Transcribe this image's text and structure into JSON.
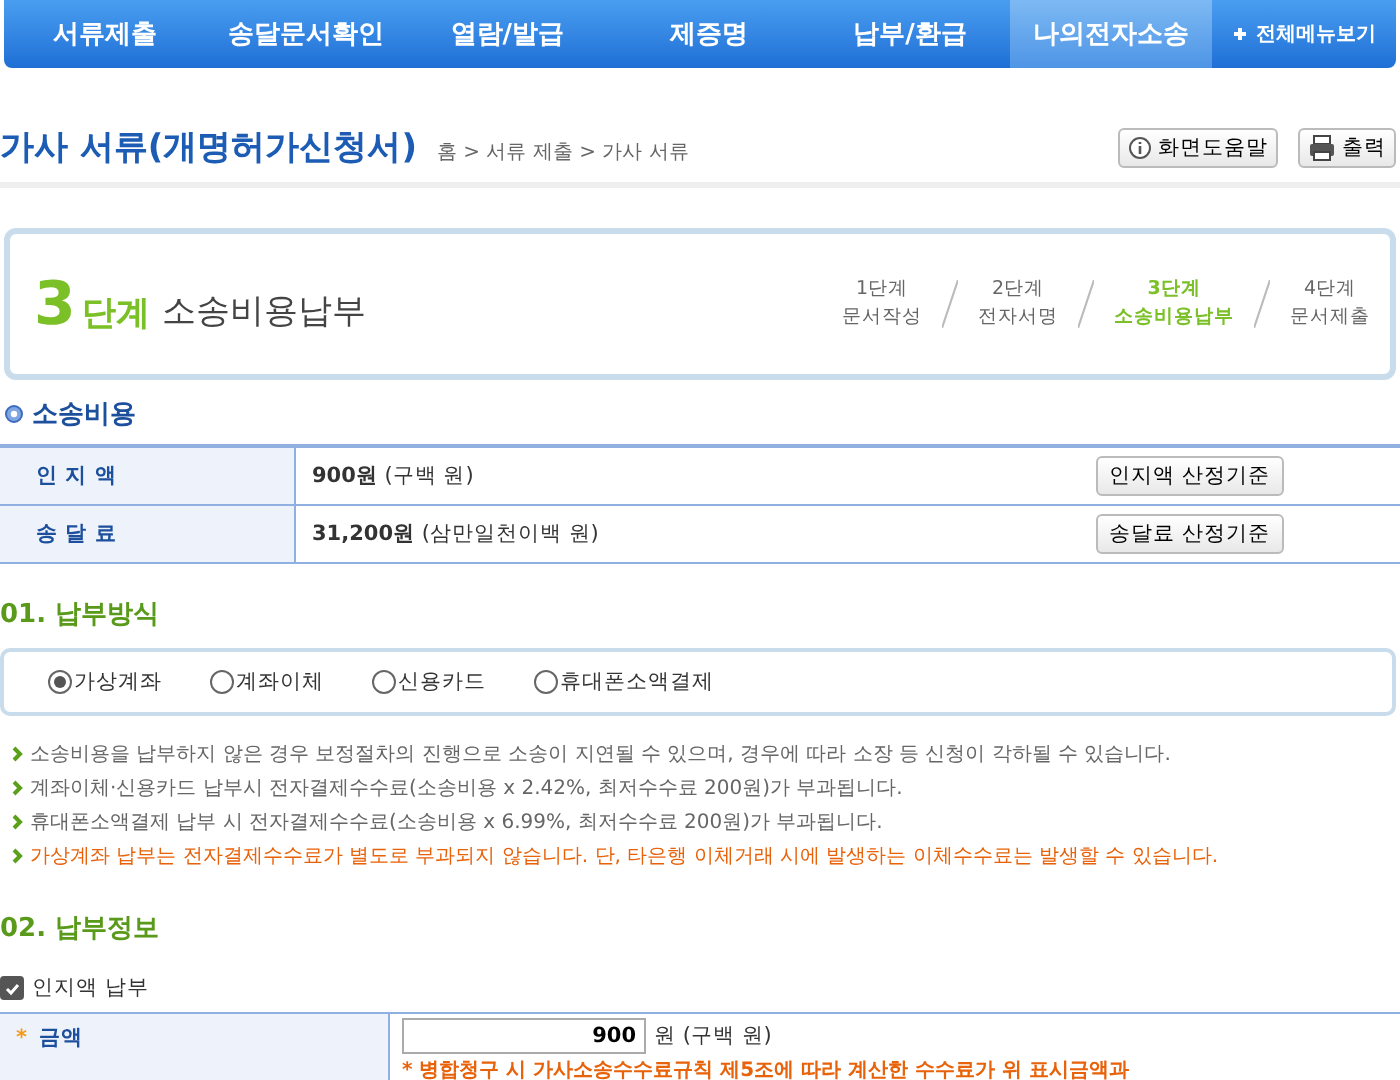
{
  "nav": {
    "items": [
      {
        "label": "서류제출",
        "selected": false
      },
      {
        "label": "송달문서확인",
        "selected": false
      },
      {
        "label": "열람/발급",
        "selected": false
      },
      {
        "label": "제증명",
        "selected": false
      },
      {
        "label": "납부/환급",
        "selected": false
      },
      {
        "label": "나의전자소송",
        "selected": true
      }
    ],
    "all_menu": "전체메뉴보기"
  },
  "header": {
    "title": "가사 서류(개명허가신청서)",
    "breadcrumb": "홈 > 서류 제출 > 가사 서류",
    "buttons": [
      {
        "label": "화면도움말",
        "kind": "help"
      },
      {
        "label": "출력",
        "kind": "print"
      }
    ]
  },
  "step": {
    "number": "3",
    "unit": "단계",
    "title": "소송비용납부",
    "steps": [
      {
        "line1": "1단계",
        "line2": "문서작성",
        "selected": false
      },
      {
        "line1": "2단계",
        "line2": "전자서명",
        "selected": false
      },
      {
        "line1": "3단계",
        "line2": "소송비용납부",
        "selected": true
      },
      {
        "line1": "4단계",
        "line2": "문서제출",
        "selected": false
      }
    ]
  },
  "fees": {
    "heading": "소송비용",
    "rows": [
      {
        "label": "인 지 액",
        "amount": "900원",
        "words": "(구백 원)",
        "button": "인지액 산정기준"
      },
      {
        "label": "송 달 료",
        "amount": "31,200원",
        "words": "(삼만일천이백 원)",
        "button": "송달료 산정기준"
      }
    ]
  },
  "methods": {
    "heading": "01. 납부방식",
    "options": [
      {
        "label": "가상계좌",
        "selected": true
      },
      {
        "label": "계좌이체",
        "selected": false
      },
      {
        "label": "신용카드",
        "selected": false
      },
      {
        "label": "휴대폰소액결제",
        "selected": false
      }
    ]
  },
  "notes": [
    {
      "text": "소송비용을 납부하지 않은 경우 보정절차의 진행으로 소송이 지연될 수 있으며, 경우에 따라 소장 등 신청이 각하될 수 있습니다.",
      "kind": "normal"
    },
    {
      "text": "계좌이체·신용카드 납부시 전자결제수수료(소송비용 x 2.42%, 최저수수료 200원)가 부과됩니다.",
      "kind": "normal"
    },
    {
      "text": "휴대폰소액결제 납부 시 전자결제수수료(소송비용 x 6.99%, 최저수수료 200원)가 부과됩니다.",
      "kind": "normal"
    },
    {
      "text": "가상계좌 납부는 전자결제수수료가 별도로 부과되지 않습니다. 단, 타은행 이체거래 시에 발생하는 이체수수료는 발생할 수 있습니다.",
      "kind": "warning"
    }
  ],
  "info": {
    "heading": "02. 납부정보",
    "checkbox": {
      "label": "인지액 납부",
      "checked": true
    },
    "row": {
      "marker": "*",
      "label": "금액",
      "value": "900",
      "unit": "원 (구백 원)",
      "note": "* 병합청구 시 가사소송수수료규칙 제5조에 따라 계산한 수수료가 위 표시금액과"
    }
  }
}
